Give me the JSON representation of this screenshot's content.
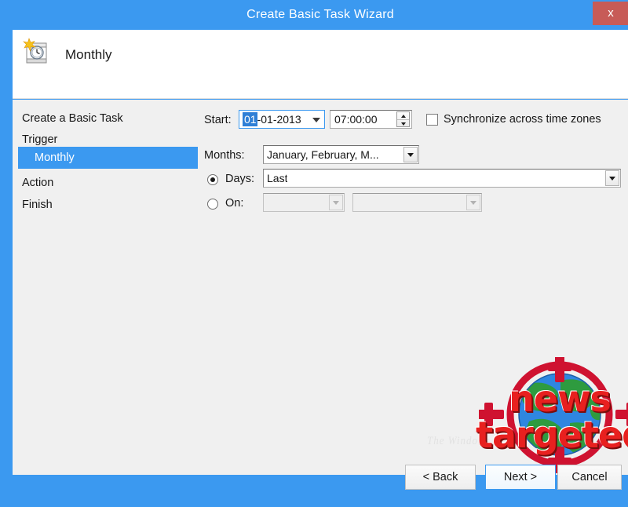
{
  "window": {
    "title": "Create Basic Task Wizard",
    "close_label": "x"
  },
  "header": {
    "icon": "calendar-clock-icon",
    "title": "Monthly"
  },
  "sidebar": {
    "items": [
      {
        "label": "Create a Basic Task",
        "selected": false,
        "indented": false
      },
      {
        "label": "Trigger",
        "selected": false,
        "indented": false
      },
      {
        "label": "Monthly",
        "selected": true,
        "indented": true
      },
      {
        "label": "Action",
        "selected": false,
        "indented": false
      },
      {
        "label": "Finish",
        "selected": false,
        "indented": false
      }
    ]
  },
  "form": {
    "start": {
      "label": "Start:",
      "date_selected_segment": "01",
      "date_rest": "-01-2013",
      "date_value": "01-01-2013",
      "time_value": "07:00:00"
    },
    "sync_checkbox": {
      "label": "Synchronize across time zones",
      "checked": false
    },
    "months": {
      "label": "Months:",
      "value": "January, February, M..."
    },
    "days": {
      "label": "Days:",
      "value": "Last",
      "selected": true
    },
    "on": {
      "label": "On:",
      "first_value": "",
      "second_value": "",
      "selected": false,
      "disabled": true
    }
  },
  "footer": {
    "back_label": "< Back",
    "next_label": "Next >",
    "cancel_label": "Cancel"
  },
  "watermarks": {
    "faint_text": "The Windows C",
    "logo_word_1": "news",
    "logo_word_2": "targeted"
  },
  "colors": {
    "accent_blue": "#3b99f0",
    "close_red": "#c75b57",
    "body_gray": "#f0f0f0",
    "logo_red": "#e8201f"
  }
}
